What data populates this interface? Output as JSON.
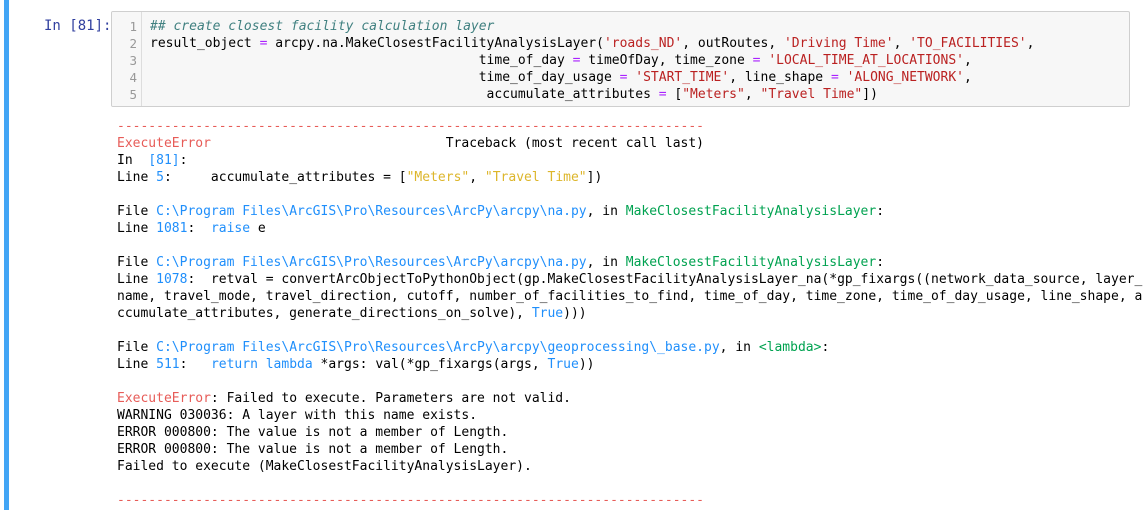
{
  "prompt": "In [81]:",
  "input": {
    "line_numbers": [
      "1",
      "2",
      "3",
      "4",
      "5"
    ],
    "lines": [
      [
        {
          "t": "## create closest facility calculation layer",
          "c": "cm"
        }
      ],
      [
        {
          "t": "result_object ",
          "c": ""
        },
        {
          "t": "=",
          "c": "op"
        },
        {
          "t": " arcpy.na.MakeClosestFacilityAnalysisLayer(",
          "c": ""
        },
        {
          "t": "'roads_ND'",
          "c": "str"
        },
        {
          "t": ", outRoutes, ",
          "c": ""
        },
        {
          "t": "'Driving Time'",
          "c": "str"
        },
        {
          "t": ", ",
          "c": ""
        },
        {
          "t": "'TO_FACILITIES'",
          "c": "str"
        },
        {
          "t": ",",
          "c": ""
        }
      ],
      [
        {
          "t": "                                          time_of_day ",
          "c": ""
        },
        {
          "t": "=",
          "c": "op"
        },
        {
          "t": " timeOfDay, time_zone ",
          "c": ""
        },
        {
          "t": "=",
          "c": "op"
        },
        {
          "t": " ",
          "c": ""
        },
        {
          "t": "'LOCAL_TIME_AT_LOCATIONS'",
          "c": "str"
        },
        {
          "t": ",",
          "c": ""
        }
      ],
      [
        {
          "t": "                                          time_of_day_usage ",
          "c": ""
        },
        {
          "t": "=",
          "c": "op"
        },
        {
          "t": " ",
          "c": ""
        },
        {
          "t": "'START_TIME'",
          "c": "str"
        },
        {
          "t": ", line_shape ",
          "c": ""
        },
        {
          "t": "=",
          "c": "op"
        },
        {
          "t": " ",
          "c": ""
        },
        {
          "t": "'ALONG_NETWORK'",
          "c": "str"
        },
        {
          "t": ",",
          "c": ""
        }
      ],
      [
        {
          "t": "                                           accumulate_attributes ",
          "c": ""
        },
        {
          "t": "=",
          "c": "op"
        },
        {
          "t": " [",
          "c": ""
        },
        {
          "t": "\"Meters\"",
          "c": "str"
        },
        {
          "t": ", ",
          "c": ""
        },
        {
          "t": "\"Travel Time\"",
          "c": "str"
        },
        {
          "t": "])",
          "c": ""
        }
      ]
    ]
  },
  "output": {
    "lines": [
      [
        {
          "t": "---------------------------------------------------------------------------",
          "c": "red"
        }
      ],
      [
        {
          "t": "ExecuteError",
          "c": "red"
        },
        {
          "t": "                              Traceback (most recent call last)",
          "c": ""
        }
      ],
      [
        {
          "t": "In  ",
          "c": ""
        },
        {
          "t": "[81]",
          "c": "path"
        },
        {
          "t": ":",
          "c": ""
        }
      ],
      [
        {
          "t": "Line ",
          "c": ""
        },
        {
          "t": "5",
          "c": "path"
        },
        {
          "t": ":     accumulate_attributes = [",
          "c": ""
        },
        {
          "t": "\"Meters\"",
          "c": "yel"
        },
        {
          "t": ", ",
          "c": ""
        },
        {
          "t": "\"Travel Time\"",
          "c": "yel"
        },
        {
          "t": "])",
          "c": ""
        }
      ],
      [],
      [
        {
          "t": "File ",
          "c": ""
        },
        {
          "t": "C:\\Program Files\\ArcGIS\\Pro\\Resources\\ArcPy\\arcpy\\na.py",
          "c": "path"
        },
        {
          "t": ", in ",
          "c": ""
        },
        {
          "t": "MakeClosestFacilityAnalysisLayer",
          "c": "fn"
        },
        {
          "t": ":",
          "c": ""
        }
      ],
      [
        {
          "t": "Line ",
          "c": ""
        },
        {
          "t": "1081",
          "c": "path"
        },
        {
          "t": ":  ",
          "c": ""
        },
        {
          "t": "raise",
          "c": "path"
        },
        {
          "t": " e",
          "c": ""
        }
      ],
      [],
      [
        {
          "t": "File ",
          "c": ""
        },
        {
          "t": "C:\\Program Files\\ArcGIS\\Pro\\Resources\\ArcPy\\arcpy\\na.py",
          "c": "path"
        },
        {
          "t": ", in ",
          "c": ""
        },
        {
          "t": "MakeClosestFacilityAnalysisLayer",
          "c": "fn"
        },
        {
          "t": ":",
          "c": ""
        }
      ],
      [
        {
          "t": "Line ",
          "c": ""
        },
        {
          "t": "1078",
          "c": "path"
        },
        {
          "t": ":  retval = convertArcObjectToPythonObject(gp.MakeClosestFacilityAnalysisLayer_na(*gp_fixargs((network_data_source, layer_",
          "c": ""
        }
      ],
      [
        {
          "t": "name, travel_mode, travel_direction, cutoff, number_of_facilities_to_find, time_of_day, time_zone, time_of_day_usage, line_shape, a",
          "c": ""
        }
      ],
      [
        {
          "t": "ccumulate_attributes, generate_directions_on_solve), ",
          "c": ""
        },
        {
          "t": "True",
          "c": "path"
        },
        {
          "t": ")))",
          "c": ""
        }
      ],
      [],
      [
        {
          "t": "File ",
          "c": ""
        },
        {
          "t": "C:\\Program Files\\ArcGIS\\Pro\\Resources\\ArcPy\\arcpy\\geoprocessing\\_base.py",
          "c": "path"
        },
        {
          "t": ", in ",
          "c": ""
        },
        {
          "t": "<lambda>",
          "c": "fn"
        },
        {
          "t": ":",
          "c": ""
        }
      ],
      [
        {
          "t": "Line ",
          "c": ""
        },
        {
          "t": "511",
          "c": "path"
        },
        {
          "t": ":   ",
          "c": ""
        },
        {
          "t": "return",
          "c": "path"
        },
        {
          "t": " ",
          "c": ""
        },
        {
          "t": "lambda",
          "c": "path"
        },
        {
          "t": " *args: val(*gp_fixargs(args, ",
          "c": ""
        },
        {
          "t": "True",
          "c": "path"
        },
        {
          "t": "))",
          "c": ""
        }
      ],
      [],
      [
        {
          "t": "ExecuteError",
          "c": "red"
        },
        {
          "t": ": Failed to execute. Parameters are not valid.",
          "c": ""
        }
      ],
      [
        {
          "t": "WARNING 030036: A layer with this name exists.",
          "c": ""
        }
      ],
      [
        {
          "t": "ERROR 000800: The value is not a member of Length.",
          "c": ""
        }
      ],
      [
        {
          "t": "ERROR 000800: The value is not a member of Length.",
          "c": ""
        }
      ],
      [
        {
          "t": "Failed to execute (MakeClosestFacilityAnalysisLayer).",
          "c": ""
        }
      ],
      [],
      [
        {
          "t": "---------------------------------------------------------------------------",
          "c": "red"
        }
      ]
    ]
  },
  "colors": {
    "cell_bar": "#42a5f5",
    "prompt": "#303f9f",
    "error_red": "#e75c58",
    "link_blue": "#208ffb",
    "func_green": "#00a250",
    "string_yellow": "#ddb62b"
  }
}
